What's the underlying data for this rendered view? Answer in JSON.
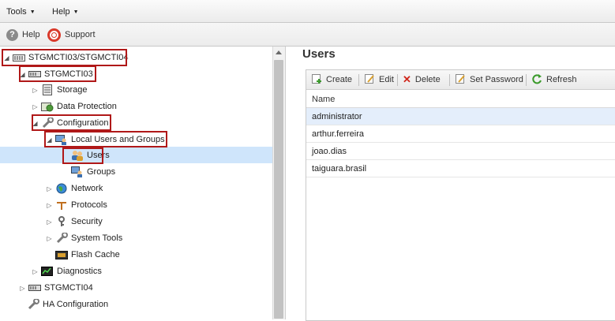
{
  "menu": {
    "tools": "Tools",
    "help": "Help"
  },
  "toolbar": {
    "help": "Help",
    "support": "Support"
  },
  "tree": {
    "root": "STGMCTI03/STGMCTI04",
    "node1": "STGMCTI03",
    "storage": "Storage",
    "data_protection": "Data Protection",
    "configuration": "Configuration",
    "local_users_groups": "Local Users and Groups",
    "users": "Users",
    "groups": "Groups",
    "network": "Network",
    "protocols": "Protocols",
    "security": "Security",
    "system_tools": "System Tools",
    "flash_cache": "Flash Cache",
    "diagnostics": "Diagnostics",
    "node2": "STGMCTI04",
    "ha_configuration": "HA Configuration"
  },
  "users_panel": {
    "title": "Users",
    "toolbar": {
      "create": "Create",
      "edit": "Edit",
      "delete": "Delete",
      "set_password": "Set Password",
      "refresh": "Refresh"
    },
    "column_name": "Name",
    "rows": [
      "administrator",
      "arthur.ferreira",
      "joao.dias",
      "taiguara.brasil"
    ]
  },
  "colors": {
    "selection": "#cfe5fb",
    "highlight_box": "#b01818"
  }
}
